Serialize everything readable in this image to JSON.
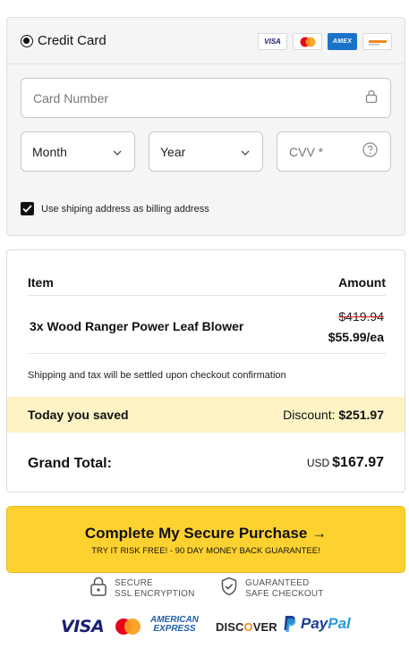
{
  "payment": {
    "method_label": "Credit Card",
    "card_logos": [
      "visa-logo",
      "mastercard-logo",
      "amex-logo",
      "discover-logo"
    ],
    "card_logo_texts": {
      "visa": "VISA",
      "amex": "AMEX"
    },
    "card_number_placeholder": "Card Number",
    "month_value": "Month",
    "year_value": "Year",
    "cvv_placeholder": "CVV *",
    "billing_checked": true,
    "billing_label": "Use shiping address as billing address"
  },
  "summary": {
    "col_item": "Item",
    "col_amount": "Amount",
    "line_item": "3x Wood Ranger Power Leaf Blower",
    "old_price": "$419.94",
    "unit_price": "$55.99/ea",
    "shipping_note": "Shipping and tax will be settled upon checkout confirmation",
    "saved_label": "Today you saved",
    "discount_label": "Discount:",
    "discount_value": "$251.97",
    "grand_label": "Grand Total:",
    "currency": "USD",
    "grand_value": "$167.97"
  },
  "cta": {
    "main": "Complete My Secure Purchase →",
    "sub": "TRY IT RISK FREE! - 90 DAY MONEY BACK GUARANTEE!"
  },
  "trust": {
    "ssl_line1": "SECURE",
    "ssl_line2": "SSL ENCRYPTION",
    "safe_line1": "GUARANTEED",
    "safe_line2": "SAFE CHECKOUT"
  },
  "brands": {
    "visa": "VISA",
    "amex_line1": "AMERICAN",
    "amex_line2": "EXPRESS",
    "discover_pre": "DISC",
    "discover_o": "O",
    "discover_post": "VER",
    "paypal_1": "Pay",
    "paypal_2": "Pal"
  },
  "colors": {
    "cta": "#fdd230",
    "saved_bar": "#fdf3c5",
    "strike": "#dd1111"
  }
}
